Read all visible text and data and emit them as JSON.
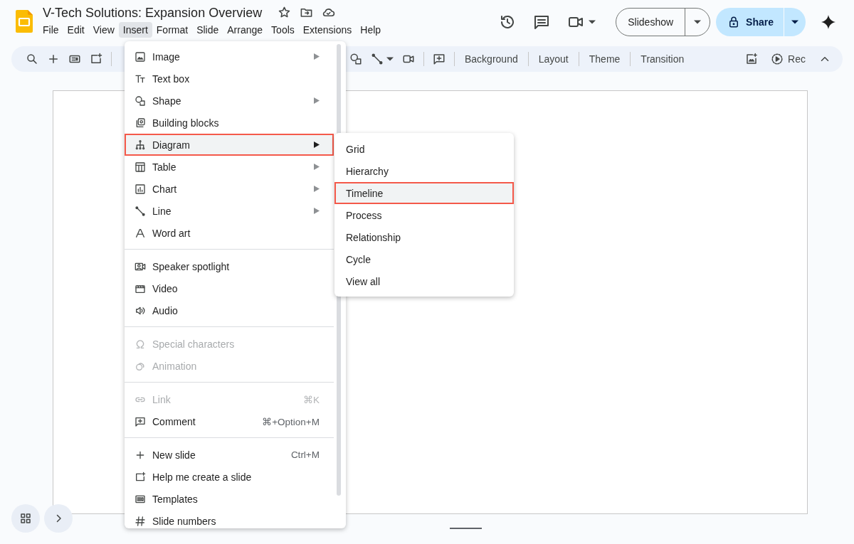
{
  "document": {
    "title": "V-Tech Solutions: Expansion Overview"
  },
  "menubar": [
    {
      "label": "File",
      "selected": false
    },
    {
      "label": "Edit",
      "selected": false
    },
    {
      "label": "View",
      "selected": false
    },
    {
      "label": "Insert",
      "selected": true
    },
    {
      "label": "Format",
      "selected": false
    },
    {
      "label": "Slide",
      "selected": false
    },
    {
      "label": "Arrange",
      "selected": false
    },
    {
      "label": "Tools",
      "selected": false
    },
    {
      "label": "Extensions",
      "selected": false
    },
    {
      "label": "Help",
      "selected": false
    }
  ],
  "header_buttons": {
    "slideshow": "Slideshow",
    "share": "Share"
  },
  "toolbar": {
    "buttons": [
      "Background",
      "Layout",
      "Theme",
      "Transition"
    ],
    "rec": "Rec"
  },
  "insert_menu": {
    "sections": [
      {
        "items": [
          {
            "label": "Image",
            "submenu": true,
            "disabled": false,
            "selected": false
          },
          {
            "label": "Text box",
            "submenu": false,
            "disabled": false,
            "selected": false
          },
          {
            "label": "Shape",
            "submenu": true,
            "disabled": false,
            "selected": false
          },
          {
            "label": "Building blocks",
            "submenu": false,
            "disabled": false,
            "selected": false
          },
          {
            "label": "Diagram",
            "submenu": true,
            "disabled": false,
            "selected": true
          },
          {
            "label": "Table",
            "submenu": true,
            "disabled": false,
            "selected": false
          },
          {
            "label": "Chart",
            "submenu": true,
            "disabled": false,
            "selected": false
          },
          {
            "label": "Line",
            "submenu": true,
            "disabled": false,
            "selected": false
          },
          {
            "label": "Word art",
            "submenu": false,
            "disabled": false,
            "selected": false
          }
        ]
      },
      {
        "items": [
          {
            "label": "Speaker spotlight",
            "submenu": false,
            "disabled": false,
            "selected": false
          },
          {
            "label": "Video",
            "submenu": false,
            "disabled": false,
            "selected": false
          },
          {
            "label": "Audio",
            "submenu": false,
            "disabled": false,
            "selected": false
          }
        ]
      },
      {
        "items": [
          {
            "label": "Special characters",
            "submenu": false,
            "disabled": true,
            "selected": false
          },
          {
            "label": "Animation",
            "submenu": false,
            "disabled": true,
            "selected": false
          }
        ]
      },
      {
        "items": [
          {
            "label": "Link",
            "shortcut": "⌘K",
            "submenu": false,
            "disabled": true,
            "selected": false
          },
          {
            "label": "Comment",
            "shortcut": "⌘+Option+M",
            "submenu": false,
            "disabled": false,
            "selected": false
          }
        ]
      },
      {
        "items": [
          {
            "label": "New slide",
            "shortcut": "Ctrl+M",
            "submenu": false,
            "disabled": false,
            "selected": false
          },
          {
            "label": "Help me create a slide",
            "submenu": false,
            "disabled": false,
            "selected": false
          },
          {
            "label": "Templates",
            "submenu": false,
            "disabled": false,
            "selected": false
          },
          {
            "label": "Slide numbers",
            "submenu": false,
            "disabled": false,
            "selected": false
          }
        ]
      }
    ]
  },
  "diagram_submenu": {
    "items": [
      {
        "label": "Grid",
        "selected": false
      },
      {
        "label": "Hierarchy",
        "selected": false
      },
      {
        "label": "Timeline",
        "selected": true
      },
      {
        "label": "Process",
        "selected": false
      },
      {
        "label": "Relationship",
        "selected": false
      },
      {
        "label": "Cycle",
        "selected": false
      },
      {
        "label": "View all",
        "selected": false
      }
    ]
  }
}
